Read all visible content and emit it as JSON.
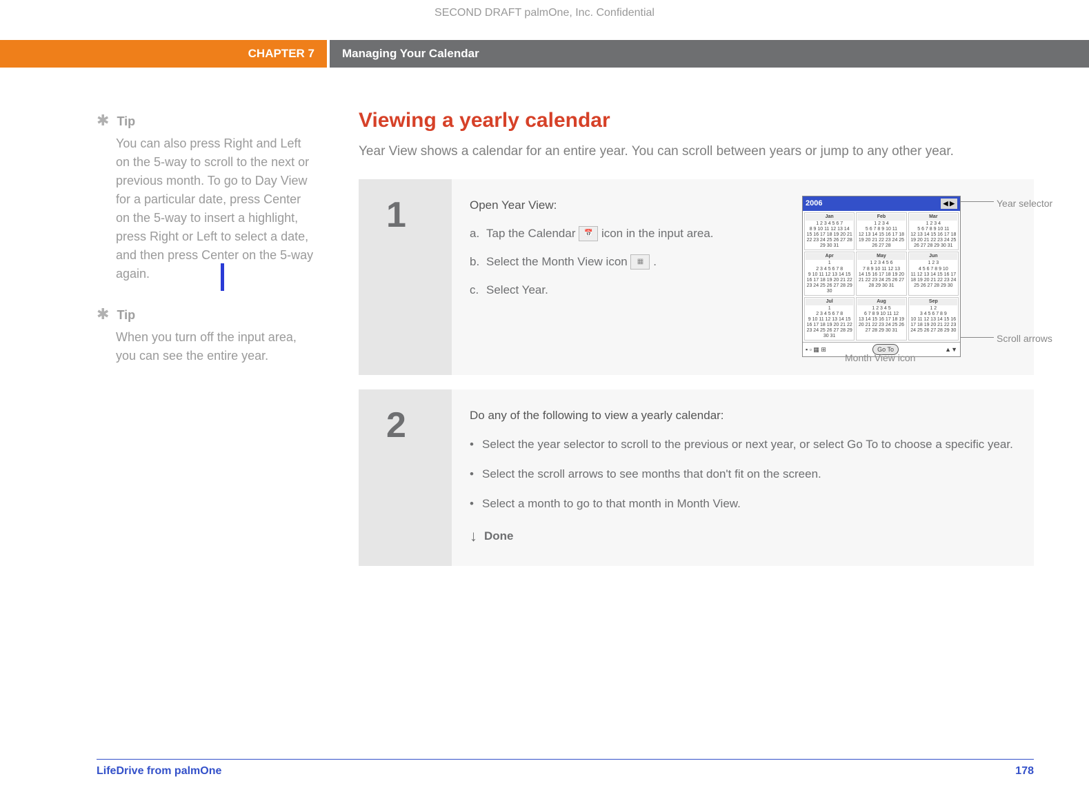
{
  "draft_header": "SECOND DRAFT palmOne, Inc.  Confidential",
  "chapter": {
    "label": "CHAPTER 7",
    "title": "Managing Your Calendar"
  },
  "sidebar": {
    "tips": [
      {
        "label": "Tip",
        "body": "You can also press Right and Left on the 5-way to scroll to the next or previous month. To go to Day View for a particular date, press Center on the 5-way to insert a highlight, press Right or Left to select a date, and then press Center on the 5-way again."
      },
      {
        "label": "Tip",
        "body": "When you turn off the input area, you can see the entire year."
      }
    ]
  },
  "section": {
    "title": "Viewing a yearly calendar",
    "intro": "Year View shows a calendar for an entire year. You can scroll between years or jump to any other year."
  },
  "step1": {
    "number": "1",
    "lead": "Open Year View:",
    "items": [
      {
        "letter": "a.",
        "pre": "Tap the Calendar ",
        "icon": "calendar",
        "post": " icon in the input area."
      },
      {
        "letter": "b.",
        "pre": "Select the Month View icon ",
        "icon": "month-view",
        "post": "."
      },
      {
        "letter": "c.",
        "pre": "Select Year.",
        "icon": "",
        "post": ""
      }
    ],
    "screenshot": {
      "year": "2006",
      "months": [
        "Jan",
        "Feb",
        "Mar",
        "Apr",
        "May",
        "Jun",
        "Jul",
        "Aug",
        "Sep"
      ],
      "goto": "Go To",
      "callouts": {
        "year_selector": "Year selector",
        "scroll_arrows": "Scroll arrows",
        "month_view_icon": "Month View icon"
      }
    }
  },
  "step2": {
    "number": "2",
    "lead": "Do any of the following to view a yearly calendar:",
    "bullets": [
      "Select the year selector to scroll to the previous or next year, or select Go To to choose a specific year.",
      "Select the scroll arrows to see months that don't fit on the screen.",
      "Select a month to go to that month in Month View."
    ],
    "done": "Done"
  },
  "footer": {
    "product": "LifeDrive from palmOne",
    "page": "178"
  }
}
